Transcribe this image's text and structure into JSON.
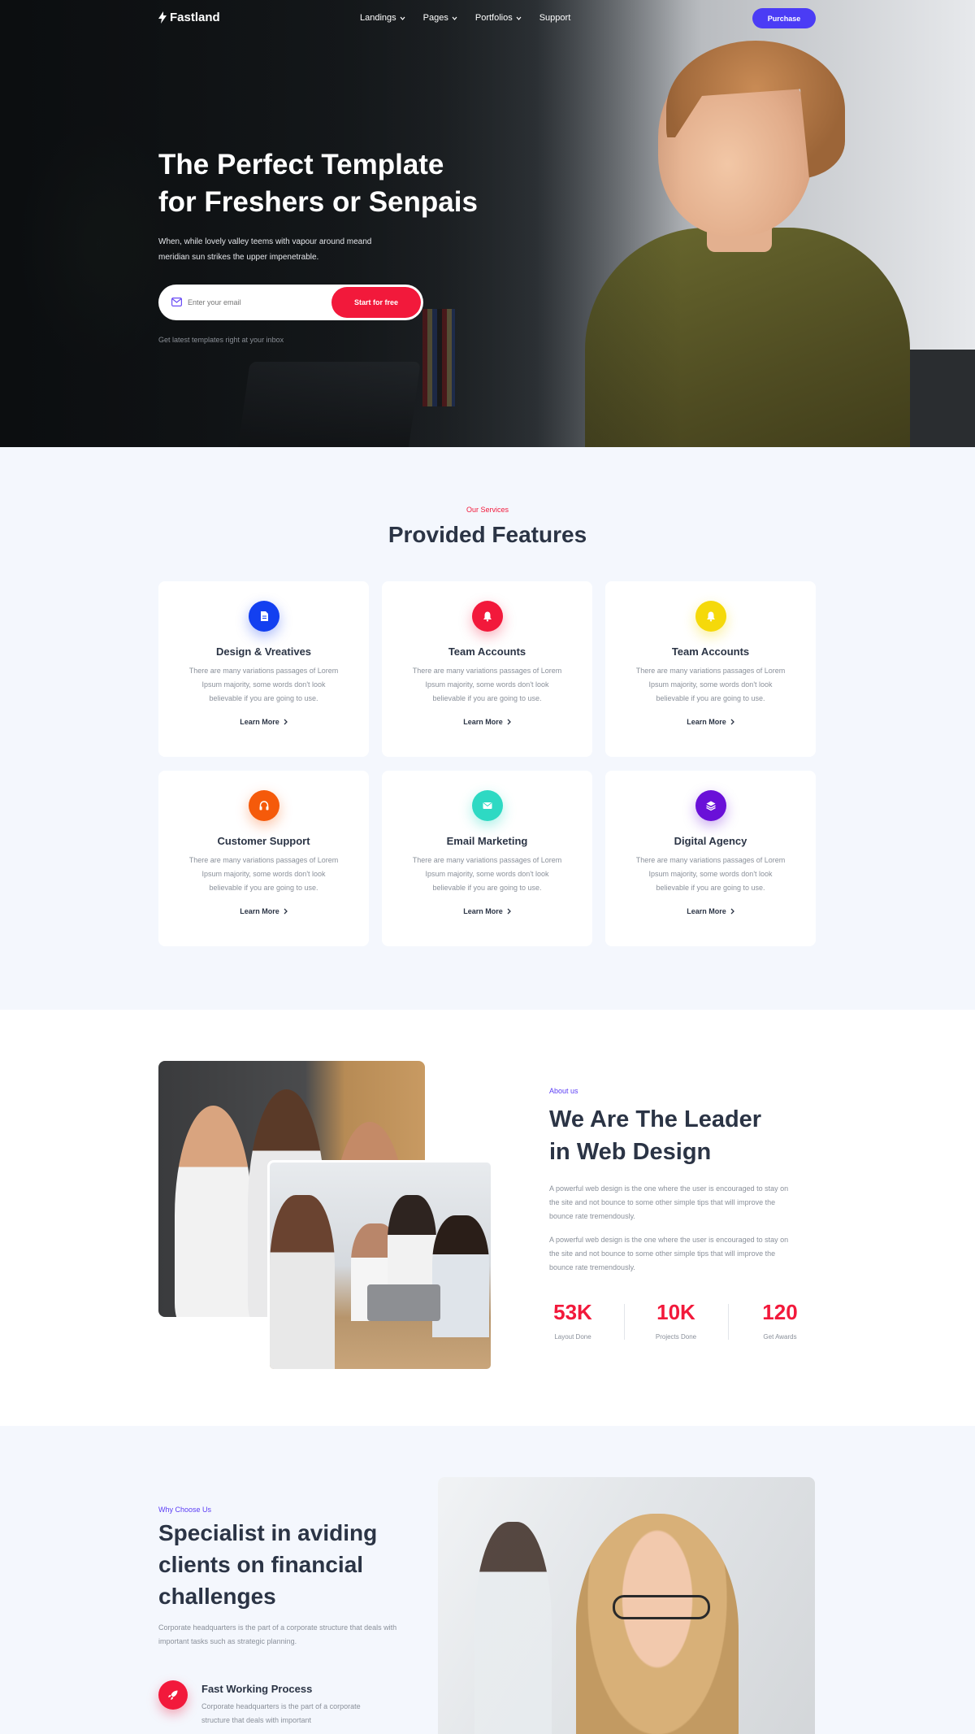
{
  "nav": {
    "brand": "Fastland",
    "links": [
      "Landings",
      "Pages",
      "Portfolios",
      "Support"
    ],
    "purchase_label": "Purchase"
  },
  "hero": {
    "title_line1": "The Perfect Template",
    "title_line2": "for Freshers or Senpais",
    "subtitle": "When, while lovely valley teems with vapour around meand meridian sun strikes the upper impenetrable.",
    "email_placeholder": "Enter your email",
    "cta_label": "Start for free",
    "note": "Get latest templates right at your inbox"
  },
  "features": {
    "eyebrow": "Our Services",
    "title": "Provided Features",
    "cards": [
      {
        "title": "Design & Vreatives",
        "text": "There are many variations passages of Lorem Ipsum majority, some words don't look believable if you are going to use.",
        "link": "Learn More",
        "icon": "document-icon",
        "color": "#1340f0"
      },
      {
        "title": "Team Accounts",
        "text": "There are many variations passages of Lorem Ipsum majority, some words don't look believable if you are going to use.",
        "link": "Learn More",
        "icon": "bell-icon",
        "color": "#f2193b"
      },
      {
        "title": "Team Accounts",
        "text": "There are many variations passages of Lorem Ipsum majority, some words don't look believable if you are going to use.",
        "link": "Learn More",
        "icon": "bell-icon",
        "color": "#f5d90a"
      },
      {
        "title": "Customer Support",
        "text": "There are many variations passages of Lorem Ipsum majority, some words don't look believable if you are going to use.",
        "link": "Learn More",
        "icon": "headphones-icon",
        "color": "#f55a0a"
      },
      {
        "title": "Email Marketing",
        "text": "There are many variations passages of Lorem Ipsum majority, some words don't look believable if you are going to use.",
        "link": "Learn More",
        "icon": "envelope-icon",
        "color": "#2ed9c3"
      },
      {
        "title": "Digital Agency",
        "text": "There are many variations passages of Lorem Ipsum majority, some words don't look believable if you are going to use.",
        "link": "Learn More",
        "icon": "layers-icon",
        "color": "#6a10d8"
      }
    ]
  },
  "about": {
    "eyebrow": "About us",
    "title_line1": "We Are The Leader",
    "title_line2": "in Web Design",
    "para1": "A powerful web design is the one where the user is encouraged to stay on the site and not bounce to some other simple tips that will improve the bounce rate tremendously.",
    "para2": "A powerful web design is the one where the user is encouraged to stay on the site and not bounce to some other simple tips that will improve the bounce rate tremendously.",
    "stats": [
      {
        "value": "53K",
        "label": "Layout Done"
      },
      {
        "value": "10K",
        "label": "Projects Done"
      },
      {
        "value": "120",
        "label": "Get Awards"
      }
    ]
  },
  "why": {
    "eyebrow": "Why Choose Us",
    "title_line1": "Specialist in aviding",
    "title_line2": "clients on financial",
    "title_line3": "challenges",
    "para": "Corporate headquarters is the part of a corporate structure that deals with important tasks such as strategic planning.",
    "feature_title": "Fast Working Process",
    "feature_text": "Corporate headquarters is the part of a corporate structure that deals with important"
  },
  "colors": {
    "accent_red": "#f2193b",
    "accent_purple": "#4b3cf5"
  }
}
